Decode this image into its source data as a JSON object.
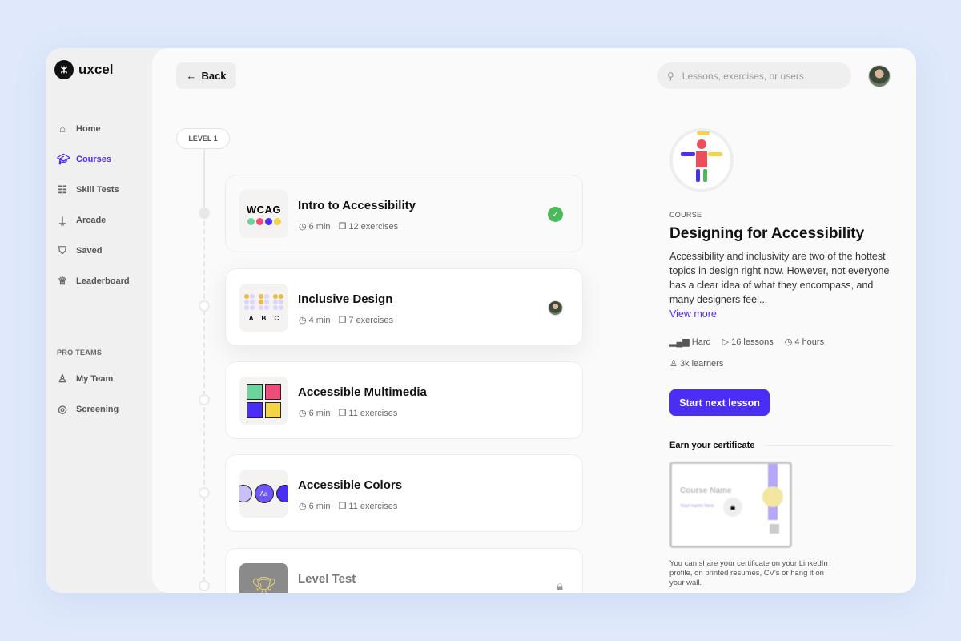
{
  "brand": {
    "name": "uxcel"
  },
  "sidebar": {
    "items": [
      {
        "label": "Home",
        "icon": "home-icon"
      },
      {
        "label": "Courses",
        "icon": "graduation-cap-icon",
        "active": true
      },
      {
        "label": "Skill Tests",
        "icon": "checklist-icon"
      },
      {
        "label": "Arcade",
        "icon": "joystick-icon"
      },
      {
        "label": "Saved",
        "icon": "bookmark-icon"
      },
      {
        "label": "Leaderboard",
        "icon": "trophy-icon"
      }
    ],
    "section_label": "PRO TEAMS",
    "team_items": [
      {
        "label": "My Team",
        "icon": "user-icon"
      },
      {
        "label": "Screening",
        "icon": "target-icon"
      }
    ]
  },
  "header": {
    "back_label": "Back",
    "search_placeholder": "Lessons, exercises, or users"
  },
  "level": {
    "label": "LEVEL 1"
  },
  "lessons": [
    {
      "title": "Intro to Accessibility",
      "duration": "6 min",
      "exercises": "12 exercises",
      "thumb_text": "WCAG",
      "status": "completed"
    },
    {
      "title": "Inclusive Design",
      "duration": "4 min",
      "exercises": "7 exercises",
      "thumb_text": "A B C",
      "status": "in-progress"
    },
    {
      "title": "Accessible Multimedia",
      "duration": "6 min",
      "exercises": "11 exercises",
      "status": "not-started"
    },
    {
      "title": "Accessible Colors",
      "duration": "6 min",
      "exercises": "11 exercises",
      "thumb_text": "Aa",
      "status": "not-started"
    },
    {
      "title": "Level Test",
      "status": "locked"
    }
  ],
  "course": {
    "kicker": "COURSE",
    "title": "Designing for Accessibility",
    "description": "Accessibility and inclusivity are two of the hottest topics in design right now. However, not everyone has a clear idea of what they encompass, and many designers feel...",
    "view_more": "View more",
    "difficulty": "Hard",
    "lessons": "16 lessons",
    "duration": "4 hours",
    "learners": "3k learners",
    "start_label": "Start next lesson",
    "certificate": {
      "heading": "Earn your certificate",
      "preview_title": "Course Name",
      "preview_name": "Your name here",
      "description": "You can share your certificate on your LinkedIn profile, on printed resumes, CV's or hang it on your wall."
    }
  },
  "colors": {
    "accent": "#4b2ef5",
    "success": "#4cba5a",
    "background": "#dfe9fb"
  }
}
